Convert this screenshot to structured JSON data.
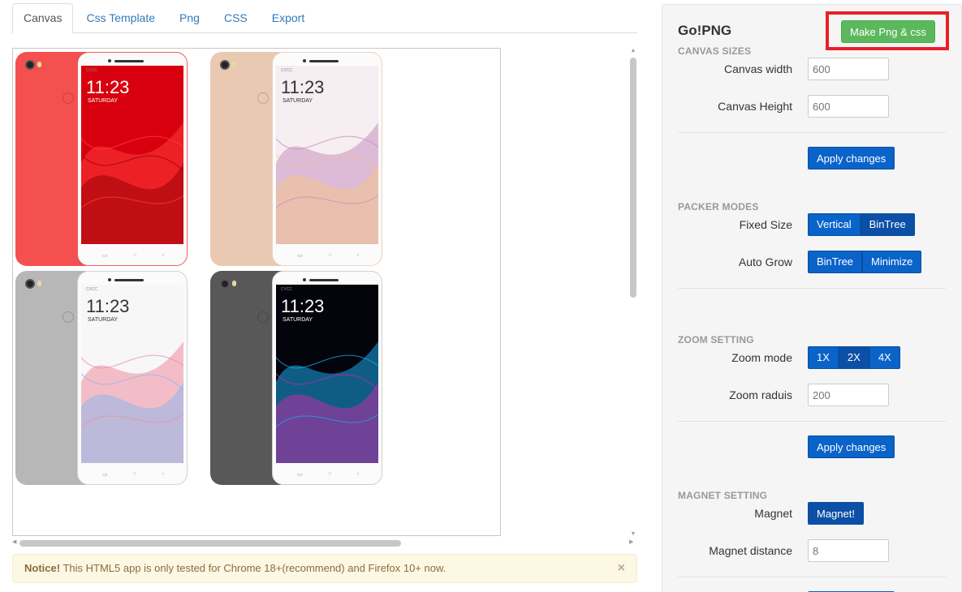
{
  "tabs": [
    {
      "label": "Canvas",
      "active": true
    },
    {
      "label": "Css Template",
      "active": false
    },
    {
      "label": "Png",
      "active": false
    },
    {
      "label": "CSS",
      "active": false
    },
    {
      "label": "Export",
      "active": false
    }
  ],
  "canvas": {
    "phones": [
      {
        "name": "phone-red",
        "back_color": "#f4504f",
        "frame_color": "#f05a5a",
        "screen_bg": "#d8000e",
        "wave_a": "#ff3a3a",
        "wave_b": "#9a0008",
        "text_color": "#ffffff",
        "time": "11:23",
        "day": "SATURDAY",
        "status": "CVCC"
      },
      {
        "name": "phone-gold",
        "back_color": "#e9c9b1",
        "frame_color": "#ecd2bf",
        "screen_bg": "#f6eef1",
        "wave_a": "#c98fbf",
        "wave_b": "#f3c28c",
        "text_color": "#333333",
        "time": "11:23",
        "day": "SATURDAY",
        "status": "CVCC"
      },
      {
        "name": "phone-silver",
        "back_color": "#b7b7b7",
        "frame_color": "#d2d2d2",
        "screen_bg": "#f7f7f8",
        "wave_a": "#f08ea0",
        "wave_b": "#8fb7ea",
        "text_color": "#333333",
        "time": "11:23",
        "day": "SATURDAY",
        "status": "CVCC"
      },
      {
        "name": "phone-dark",
        "back_color": "#585858",
        "frame_color": "#cfcfcf",
        "screen_bg": "#04040c",
        "wave_a": "#1aa8e8",
        "wave_b": "#c02ca8",
        "text_color": "#ffffff",
        "time": "11:23",
        "day": "SATURDAY",
        "status": "CVCC"
      }
    ]
  },
  "notice": {
    "strong": "Notice!",
    "text": "This HTML5 app is only tested for Chrome 18+(recommend) and Firefox 10+ now.",
    "close": "×"
  },
  "panel": {
    "title": "Go!PNG",
    "make_button": "Make Png & css",
    "canvas_sizes": {
      "heading": "CANVAS SIZES",
      "width_label": "Canvas width",
      "width_placeholder": "600",
      "height_label": "Canvas Height",
      "height_placeholder": "600",
      "apply": "Apply changes"
    },
    "packer_modes": {
      "heading": "PACKER MODES",
      "fixed_size_label": "Fixed Size",
      "fixed_size_options": [
        "Vertical",
        "BinTree"
      ],
      "auto_grow_label": "Auto Grow",
      "auto_grow_options": [
        "BinTree",
        "Minimize"
      ]
    },
    "zoom_setting": {
      "heading": "ZOOM SETTING",
      "mode_label": "Zoom mode",
      "mode_options": [
        "1X",
        "2X",
        "4X"
      ],
      "radius_label": "Zoom raduis",
      "radius_placeholder": "200",
      "apply": "Apply changes"
    },
    "magnet_setting": {
      "heading": "MAGNET SETTING",
      "magnet_label": "Magnet",
      "magnet_button": "Magnet!",
      "distance_label": "Magnet distance",
      "distance_placeholder": "8"
    }
  }
}
